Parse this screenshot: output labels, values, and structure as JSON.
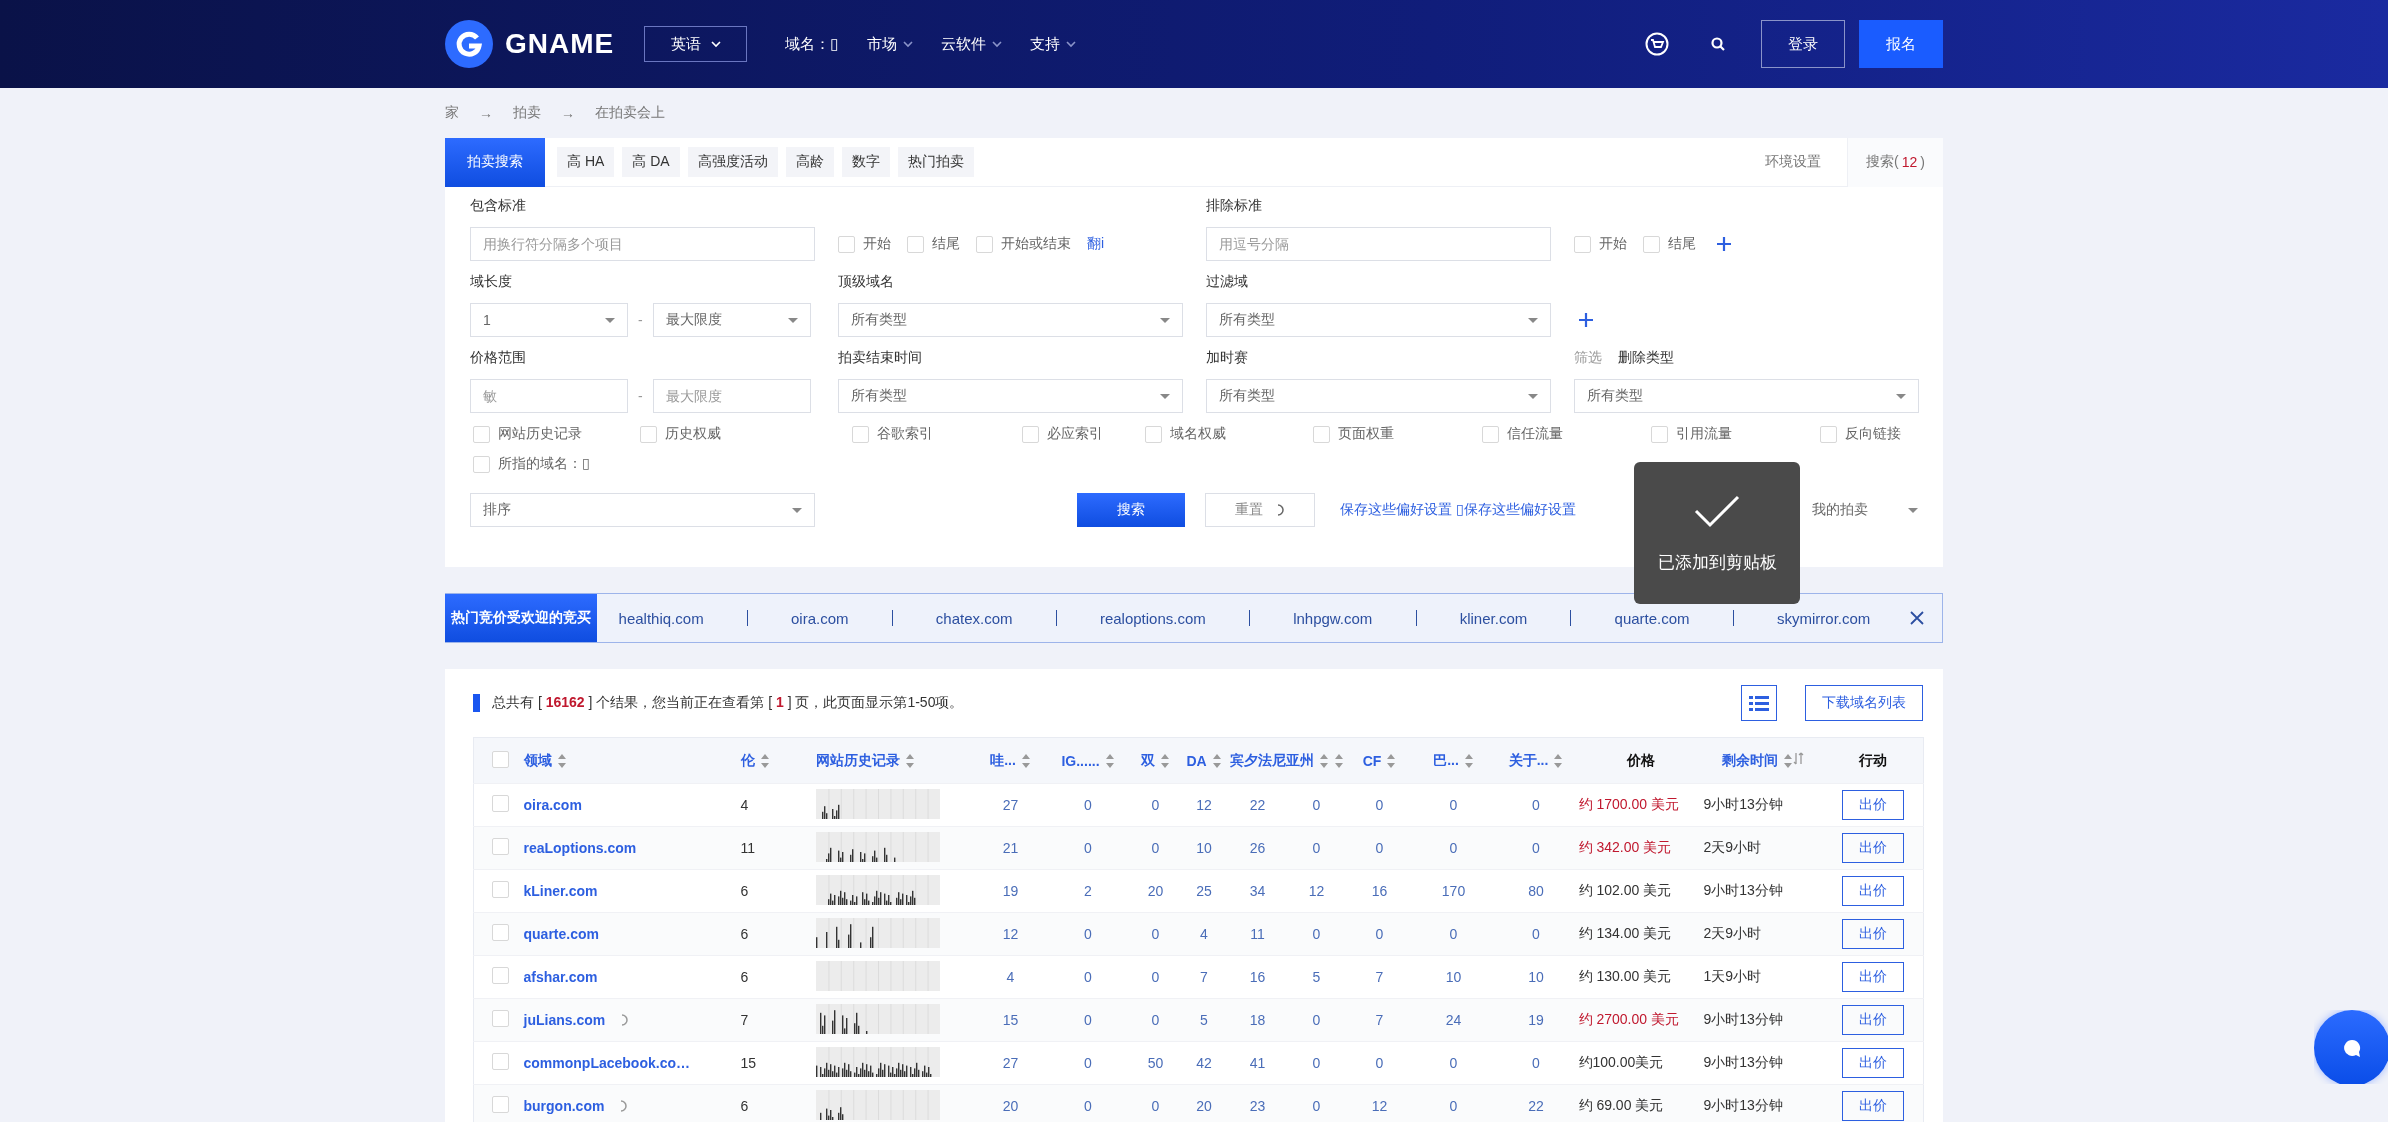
{
  "header": {
    "logo": "GNAME",
    "language": "英语",
    "nav": [
      {
        "label": "域名：▯",
        "dropdown": false
      },
      {
        "label": "市场",
        "dropdown": true
      },
      {
        "label": "云软件",
        "dropdown": true
      },
      {
        "label": "支持",
        "dropdown": true
      }
    ],
    "login": "登录",
    "signup": "报名"
  },
  "breadcrumb": {
    "separator": "→",
    "items": [
      "家",
      "拍卖",
      "在拍卖会上"
    ]
  },
  "filters": {
    "tabs": [
      {
        "label": "拍卖搜索",
        "selected": true
      },
      {
        "label": "高 HA",
        "selected": false
      },
      {
        "label": "高 DA",
        "selected": false
      },
      {
        "label": "高强度活动",
        "selected": false
      },
      {
        "label": "高龄",
        "selected": false
      },
      {
        "label": "数字",
        "selected": false
      },
      {
        "label": "热门拍卖",
        "selected": false
      }
    ],
    "settings_link": "环境设置",
    "saved_searches": {
      "label": "搜索(",
      "count": "12",
      "suffix": ")"
    },
    "include": {
      "label": "包含标准",
      "placeholder": "用换行符分隔多个项目",
      "options": [
        {
          "label": "开始",
          "checked": false
        },
        {
          "label": "结尾",
          "checked": false
        },
        {
          "label": "开始或结束",
          "checked": false
        }
      ],
      "link": "翻i"
    },
    "exclude": {
      "label": "排除标准",
      "placeholder": "用逗号分隔",
      "options": [
        {
          "label": "开始",
          "checked": false
        },
        {
          "label": "结尾",
          "checked": false
        }
      ]
    },
    "length": {
      "label": "域长度",
      "min": "1",
      "separator": "-",
      "max": "最大限度"
    },
    "tld": {
      "label": "顶级域名",
      "value": "所有类型"
    },
    "filter_domain": {
      "label": "过滤域",
      "value": "所有类型"
    },
    "price": {
      "label": "价格范围",
      "min_placeholder": "敏",
      "separator": "-",
      "max_placeholder": "最大限度"
    },
    "end_time": {
      "label": "拍卖结束时间",
      "value": "所有类型"
    },
    "overtime": {
      "label": "加时赛",
      "value": "所有类型"
    },
    "delete_type": {
      "tabs": [
        {
          "label": "筛选",
          "selected": false
        },
        {
          "label": "删除类型",
          "selected": true
        }
      ],
      "value": "所有类型"
    },
    "metric_options": [
      {
        "label": "网站历史记录",
        "checked": false
      },
      {
        "label": "历史权威",
        "checked": false
      },
      {
        "label": "谷歌索引",
        "checked": false
      },
      {
        "label": "必应索引",
        "checked": false
      },
      {
        "label": "域名权威",
        "checked": false
      },
      {
        "label": "页面权重",
        "checked": false
      },
      {
        "label": "信任流量",
        "checked": false
      },
      {
        "label": "引用流量",
        "checked": false
      },
      {
        "label": "反向链接",
        "checked": false
      },
      {
        "label": "所指的域名：▯",
        "checked": false
      }
    ],
    "sort": {
      "placeholder": "排序"
    },
    "search_button": "搜索",
    "reset_button": "重置",
    "reset_loading": true,
    "save_link": "保存这些偏好设置 ▯保存这些偏好设置",
    "my_auctions": "我的拍卖"
  },
  "hot": {
    "label": "热门竞价受欢迎的竞买",
    "domains": [
      "healthiq.com",
      "oira.com",
      "chatex.com",
      "realoptions.com",
      "lnhpgw.com",
      "kliner.com",
      "quarte.com",
      "skymirror.com"
    ]
  },
  "results": {
    "summary": "总共有 [ **16162** ] 个结果，您当前正在查看第 [ **1** ] 页，此页面显示第1-50项。",
    "download": "下载域名列表",
    "select_all_checked": false,
    "columns": [
      {
        "label": "领域",
        "sortable": true
      },
      {
        "label": "伦",
        "sortable": true
      },
      {
        "label": "网站历史记录",
        "sortable": true
      },
      {
        "label": "哇...",
        "sortable": true
      },
      {
        "label": "IG......",
        "sortable": true
      },
      {
        "label": "双",
        "sortable": true
      },
      {
        "label": "DA",
        "sortable": true
      },
      {
        "label": "宾夕法尼亚州",
        "sortable": true
      },
      {
        "sortable": true
      },
      {
        "label": "CF",
        "sortable": true
      },
      {
        "label": "巴...",
        "sortable": true
      },
      {
        "label": "关于...",
        "sortable": true
      },
      {
        "label": "价格",
        "sortable": false
      },
      {
        "label": "剩余时间",
        "sortable": true
      },
      {
        "label": "行动",
        "sortable": false
      }
    ],
    "rows": [
      {
        "checked": false,
        "domain": "oira.com",
        "loading": false,
        "length": "4",
        "metrics": [
          "27",
          "0",
          "0",
          "12",
          "22",
          "0",
          "0",
          "0",
          "0"
        ],
        "price": "约 1700.00 美元",
        "price_highlight": true,
        "time": "9小时13分钟",
        "action": "出价"
      },
      {
        "checked": false,
        "domain": "reaLoptions.com",
        "loading": false,
        "length": "11",
        "metrics": [
          "21",
          "0",
          "0",
          "10",
          "26",
          "0",
          "0",
          "0",
          "0"
        ],
        "price": "约 342.00 美元",
        "price_highlight": true,
        "time": "2天9小时",
        "action": "出价"
      },
      {
        "checked": false,
        "domain": "kLiner.com",
        "loading": false,
        "length": "6",
        "metrics": [
          "19",
          "2",
          "20",
          "25",
          "34",
          "12",
          "16",
          "170",
          "80"
        ],
        "price": "约 102.00 美元",
        "price_highlight": false,
        "time": "9小时13分钟",
        "action": "出价"
      },
      {
        "checked": false,
        "domain": "quarte.com",
        "loading": false,
        "length": "6",
        "metrics": [
          "12",
          "0",
          "0",
          "4",
          "11",
          "0",
          "0",
          "0",
          "0"
        ],
        "price": "约 134.00 美元",
        "price_highlight": false,
        "time": "2天9小时",
        "action": "出价"
      },
      {
        "checked": false,
        "domain": "afshar.com",
        "loading": false,
        "length": "6",
        "metrics": [
          "4",
          "0",
          "0",
          "7",
          "16",
          "5",
          "7",
          "10",
          "10"
        ],
        "price": "约 130.00 美元",
        "price_highlight": false,
        "time": "1天9小时",
        "action": "出价"
      },
      {
        "checked": false,
        "domain": "juLians.com",
        "loading": true,
        "length": "7",
        "metrics": [
          "15",
          "0",
          "0",
          "5",
          "18",
          "0",
          "7",
          "24",
          "19"
        ],
        "price": "约 2700.00 美元",
        "price_highlight": true,
        "time": "9小时13分钟",
        "action": "出价"
      },
      {
        "checked": false,
        "domain": "commonpLacebook.co…",
        "loading": false,
        "length": "15",
        "metrics": [
          "27",
          "0",
          "50",
          "42",
          "41",
          "0",
          "0",
          "0",
          "0"
        ],
        "price": "约100.00美元",
        "price_highlight": false,
        "time": "9小时13分钟",
        "action": "出价"
      },
      {
        "checked": false,
        "domain": "burgon.com",
        "loading": true,
        "length": "6",
        "metrics": [
          "20",
          "0",
          "0",
          "20",
          "23",
          "0",
          "12",
          "0",
          "22"
        ],
        "price": "约 69.00 美元",
        "price_highlight": false,
        "time": "9小时13分钟",
        "action": "出价"
      }
    ]
  },
  "toast": {
    "message": "已添加到剪贴板"
  }
}
